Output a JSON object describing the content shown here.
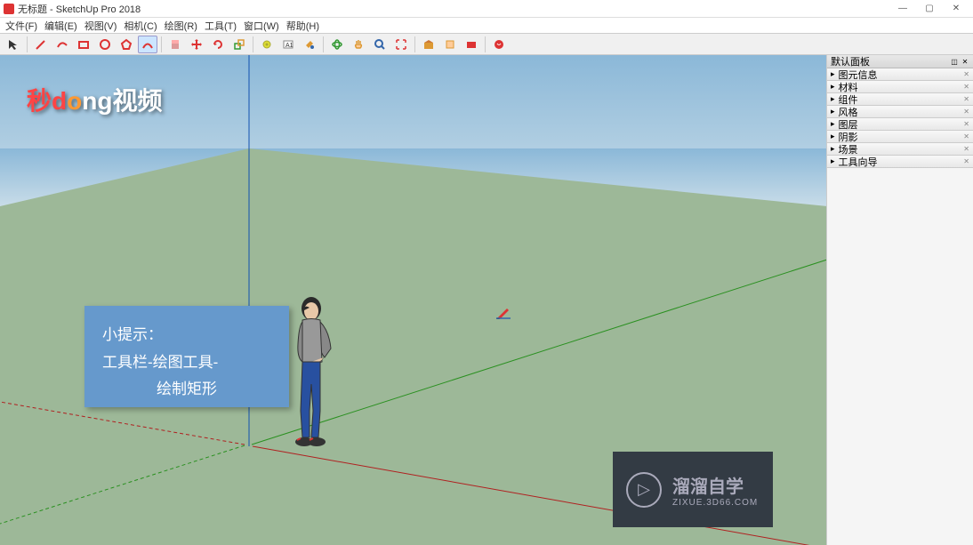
{
  "titlebar": {
    "title": "无标题 - SketchUp Pro 2018",
    "minimize": "—",
    "maximize": "▢",
    "close": "✕"
  },
  "menubar": {
    "items": [
      {
        "label": "文件(F)"
      },
      {
        "label": "编辑(E)"
      },
      {
        "label": "视图(V)"
      },
      {
        "label": "相机(C)"
      },
      {
        "label": "绘图(R)"
      },
      {
        "label": "工具(T)"
      },
      {
        "label": "窗口(W)"
      },
      {
        "label": "帮助(H)"
      }
    ]
  },
  "toolbar": {
    "tools": [
      {
        "name": "select-tool",
        "icon": "arrow"
      },
      {
        "name": "line-tool",
        "icon": "pencil"
      },
      {
        "name": "rectangle-tool",
        "icon": "rect"
      },
      {
        "name": "circle-tool",
        "icon": "circle"
      },
      {
        "name": "arc-tool",
        "icon": "arc"
      },
      {
        "name": "push-pull-tool",
        "icon": "pushpull"
      },
      {
        "name": "move-tool",
        "icon": "move"
      },
      {
        "name": "rotate-tool",
        "icon": "rotate"
      },
      {
        "name": "offset-tool",
        "icon": "offset"
      },
      {
        "name": "tape-tool",
        "icon": "tape"
      },
      {
        "name": "text-tool",
        "icon": "text"
      },
      {
        "name": "paint-tool",
        "icon": "paint"
      },
      {
        "name": "orbit-tool",
        "icon": "orbit"
      },
      {
        "name": "pan-tool",
        "icon": "pan"
      },
      {
        "name": "zoom-tool",
        "icon": "zoom"
      },
      {
        "name": "zoom-extents-tool",
        "icon": "zoome"
      },
      {
        "name": "warehouse-tool",
        "icon": "wh"
      },
      {
        "name": "warehouse2-tool",
        "icon": "wh2"
      },
      {
        "name": "layout-tool",
        "icon": "layout"
      },
      {
        "name": "style-tool",
        "icon": "style"
      }
    ]
  },
  "sidebar": {
    "header": "默认面板",
    "panels": [
      {
        "label": "图元信息"
      },
      {
        "label": "材料"
      },
      {
        "label": "组件"
      },
      {
        "label": "风格"
      },
      {
        "label": "图层"
      },
      {
        "label": "阴影"
      },
      {
        "label": "场景"
      },
      {
        "label": "工具向导"
      }
    ]
  },
  "tooltip": {
    "line1": "小提示：",
    "line2": "工具栏-绘图工具-",
    "line3": "绘制矩形"
  },
  "watermark": {
    "text_main": "秒d",
    "text_o": "o",
    "text_ng": "ng",
    "text_end": "视频"
  },
  "brand": {
    "name": "溜溜自学",
    "url": "ZIXUE.3D66.COM",
    "play": "▷"
  }
}
